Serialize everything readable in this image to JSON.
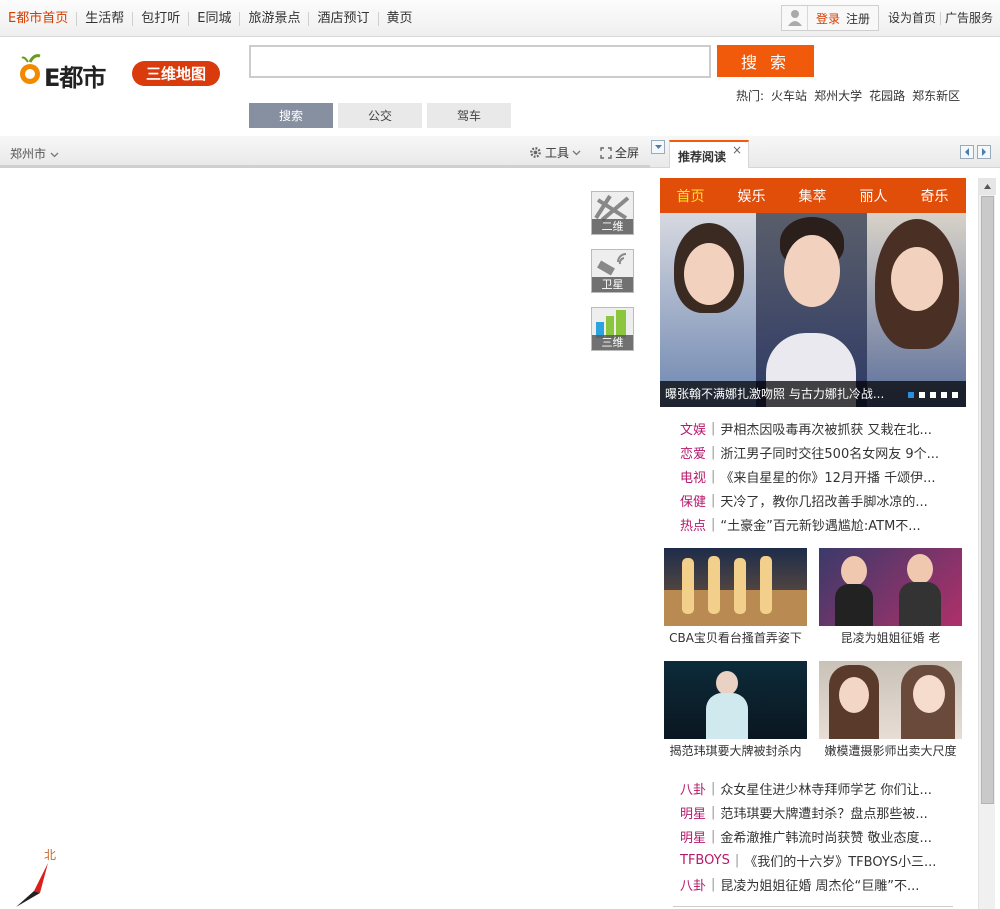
{
  "topnav": {
    "items": [
      "E都市首页",
      "生活帮",
      "包打听",
      "E同城",
      "旅游景点",
      "酒店预订",
      "黄页"
    ],
    "login": "登录",
    "register": "注册",
    "links": [
      "设为首页",
      "广告服务"
    ]
  },
  "header": {
    "logo_text": "E都市",
    "badge": "三维地图",
    "search_placeholder": "",
    "search_button": "搜 索",
    "hot_label": "热门:",
    "hot_items": [
      "火车站",
      "郑州大学",
      "花园路",
      "郑东新区"
    ],
    "modes": [
      "搜索",
      "公交",
      "驾车"
    ]
  },
  "map": {
    "city": "郑州市",
    "tools_label": "工具",
    "fullscreen_label": "全屏",
    "types": [
      "二维",
      "卫星",
      "三维"
    ],
    "compass_north": "北"
  },
  "panel": {
    "tab_title": "推荐阅读",
    "tab_close": "×",
    "categories": [
      "首页",
      "娱乐",
      "集萃",
      "丽人",
      "奇乐"
    ],
    "hero_caption": "曝张翰不满娜扎激吻照 与古力娜扎冷战...",
    "news1": [
      {
        "cat": "文娱",
        "title": "尹相杰因吸毒再次被抓获 又栽在北..."
      },
      {
        "cat": "恋爱",
        "title": "浙江男子同时交往500名女网友 9个..."
      },
      {
        "cat": "电视",
        "title": "《来自星星的你》12月开播 千颂伊..."
      },
      {
        "cat": "保健",
        "title": "天冷了，教你几招改善手脚冰凉的..."
      },
      {
        "cat": "热点",
        "title": "“土豪金”百元新钞遇尴尬:ATM不..."
      }
    ],
    "thumbs": [
      {
        "title": "CBA宝贝看台搔首弄姿下"
      },
      {
        "title": "昆凌为姐姐征婚 老"
      },
      {
        "title": "揭范玮琪要大牌被封杀内"
      },
      {
        "title": "嫩模遭摄影师出卖大尺度"
      }
    ],
    "news2": [
      {
        "cat": "八卦",
        "title": "众女星住进少林寺拜师学艺 你们让..."
      },
      {
        "cat": "明星",
        "title": "范玮琪要大牌遭封杀？盘点那些被..."
      },
      {
        "cat": "明星",
        "title": "金希澈推广韩流时尚获赞 敬业态度..."
      },
      {
        "cat": "TFBOYS",
        "title": "《我们的十六岁》TFBOYS小三..."
      },
      {
        "cat": "八卦",
        "title": "昆凌为姐姐征婚 周杰伦“巨雕”不..."
      }
    ]
  },
  "colors": {
    "accent": "#f15a0a",
    "brand_red": "#d93b0d",
    "category_magenta": "#b5196b"
  }
}
